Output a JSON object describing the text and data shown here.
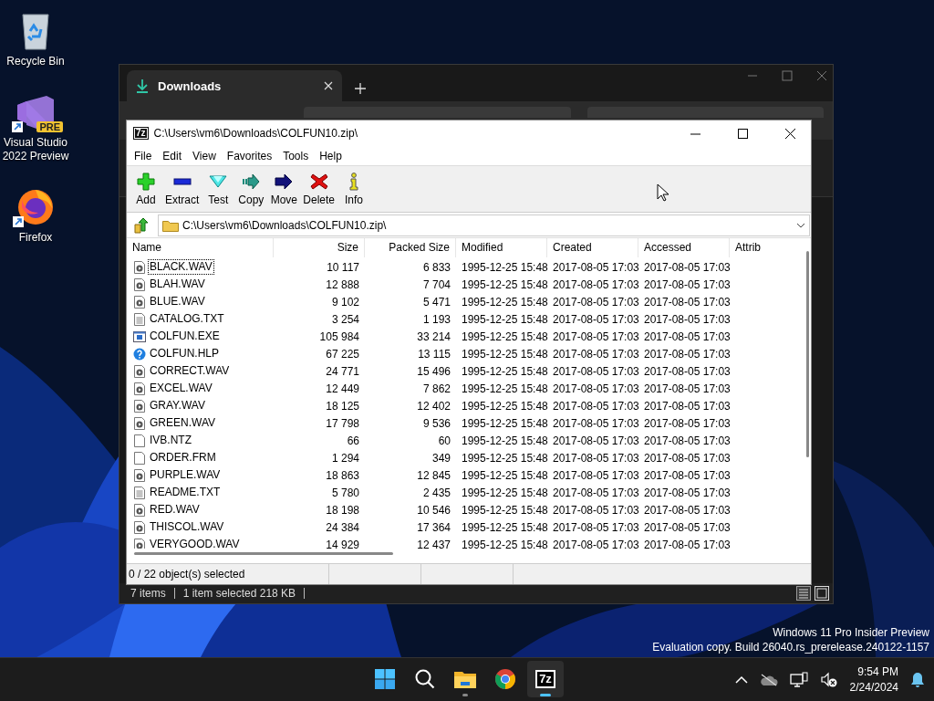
{
  "desktop_icons": [
    {
      "kind": "recycle",
      "label": "Recycle Bin"
    },
    {
      "kind": "vs",
      "label": "Visual Studio 2022 Preview",
      "badge": "PRE",
      "shortcut": true
    },
    {
      "kind": "firefox",
      "label": "Firefox",
      "shortcut": true
    }
  ],
  "explorer": {
    "tab": {
      "label": "Downloads",
      "selected": true
    },
    "status_bar": [
      "7 items",
      "1 item selected  218 KB"
    ]
  },
  "sevenzip": {
    "app_icon": "7z",
    "title": "C:\\Users\\vm6\\Downloads\\COLFUN10.zip\\",
    "menu": [
      "File",
      "Edit",
      "View",
      "Favorites",
      "Tools",
      "Help"
    ],
    "toolbar": [
      {
        "kind": "add",
        "label": "Add"
      },
      {
        "kind": "extract",
        "label": "Extract"
      },
      {
        "kind": "test",
        "label": "Test"
      },
      {
        "kind": "copy",
        "label": "Copy"
      },
      {
        "kind": "move",
        "label": "Move"
      },
      {
        "kind": "delete",
        "label": "Delete"
      },
      {
        "kind": "info",
        "label": "Info"
      }
    ],
    "path": "C:\\Users\\vm6\\Downloads\\COLFUN10.zip\\",
    "columns": [
      "Name",
      "Size",
      "Packed Size",
      "Modified",
      "Created",
      "Accessed",
      "Attrib"
    ],
    "rows": [
      {
        "kind": "wav",
        "name": "BLACK.WAV",
        "size": "10 117",
        "packed": "6 833",
        "modified": "1995-12-25 15:48",
        "created": "2017-08-05 17:03",
        "accessed": "2017-08-05 17:03",
        "focused": true
      },
      {
        "kind": "wav",
        "name": "BLAH.WAV",
        "size": "12 888",
        "packed": "7 704",
        "modified": "1995-12-25 15:48",
        "created": "2017-08-05 17:03",
        "accessed": "2017-08-05 17:03",
        "focused": false
      },
      {
        "kind": "wav",
        "name": "BLUE.WAV",
        "size": "9 102",
        "packed": "5 471",
        "modified": "1995-12-25 15:48",
        "created": "2017-08-05 17:03",
        "accessed": "2017-08-05 17:03",
        "focused": false
      },
      {
        "kind": "txt",
        "name": "CATALOG.TXT",
        "size": "3 254",
        "packed": "1 193",
        "modified": "1995-12-25 15:48",
        "created": "2017-08-05 17:03",
        "accessed": "2017-08-05 17:03",
        "focused": false
      },
      {
        "kind": "exe",
        "name": "COLFUN.EXE",
        "size": "105 984",
        "packed": "33 214",
        "modified": "1995-12-25 15:48",
        "created": "2017-08-05 17:03",
        "accessed": "2017-08-05 17:03",
        "focused": false
      },
      {
        "kind": "hlp",
        "name": "COLFUN.HLP",
        "size": "67 225",
        "packed": "13 115",
        "modified": "1995-12-25 15:48",
        "created": "2017-08-05 17:03",
        "accessed": "2017-08-05 17:03",
        "focused": false
      },
      {
        "kind": "wav",
        "name": "CORRECT.WAV",
        "size": "24 771",
        "packed": "15 496",
        "modified": "1995-12-25 15:48",
        "created": "2017-08-05 17:03",
        "accessed": "2017-08-05 17:03",
        "focused": false
      },
      {
        "kind": "wav",
        "name": "EXCEL.WAV",
        "size": "12 449",
        "packed": "7 862",
        "modified": "1995-12-25 15:48",
        "created": "2017-08-05 17:03",
        "accessed": "2017-08-05 17:03",
        "focused": false
      },
      {
        "kind": "wav",
        "name": "GRAY.WAV",
        "size": "18 125",
        "packed": "12 402",
        "modified": "1995-12-25 15:48",
        "created": "2017-08-05 17:03",
        "accessed": "2017-08-05 17:03",
        "focused": false
      },
      {
        "kind": "wav",
        "name": "GREEN.WAV",
        "size": "17 798",
        "packed": "9 536",
        "modified": "1995-12-25 15:48",
        "created": "2017-08-05 17:03",
        "accessed": "2017-08-05 17:03",
        "focused": false
      },
      {
        "kind": "file",
        "name": "IVB.NTZ",
        "size": "66",
        "packed": "60",
        "modified": "1995-12-25 15:48",
        "created": "2017-08-05 17:03",
        "accessed": "2017-08-05 17:03",
        "focused": false
      },
      {
        "kind": "file",
        "name": "ORDER.FRM",
        "size": "1 294",
        "packed": "349",
        "modified": "1995-12-25 15:48",
        "created": "2017-08-05 17:03",
        "accessed": "2017-08-05 17:03",
        "focused": false
      },
      {
        "kind": "wav",
        "name": "PURPLE.WAV",
        "size": "18 863",
        "packed": "12 845",
        "modified": "1995-12-25 15:48",
        "created": "2017-08-05 17:03",
        "accessed": "2017-08-05 17:03",
        "focused": false
      },
      {
        "kind": "txt",
        "name": "README.TXT",
        "size": "5 780",
        "packed": "2 435",
        "modified": "1995-12-25 15:48",
        "created": "2017-08-05 17:03",
        "accessed": "2017-08-05 17:03",
        "focused": false
      },
      {
        "kind": "wav",
        "name": "RED.WAV",
        "size": "18 198",
        "packed": "10 546",
        "modified": "1995-12-25 15:48",
        "created": "2017-08-05 17:03",
        "accessed": "2017-08-05 17:03",
        "focused": false
      },
      {
        "kind": "wav",
        "name": "THISCOL.WAV",
        "size": "24 384",
        "packed": "17 364",
        "modified": "1995-12-25 15:48",
        "created": "2017-08-05 17:03",
        "accessed": "2017-08-05 17:03",
        "focused": false
      },
      {
        "kind": "wav",
        "name": "VERYGOOD.WAV",
        "size": "14 929",
        "packed": "12 437",
        "modified": "1995-12-25 15:48",
        "created": "2017-08-05 17:03",
        "accessed": "2017-08-05 17:03",
        "focused": false
      }
    ],
    "status": "0 / 22 object(s) selected"
  },
  "system_notice": [
    "Windows 11 Pro Insider Preview",
    "Evaluation copy. Build 26040.rs_prerelease.240122-1157"
  ],
  "taskbar": {
    "apps": [
      {
        "kind": "start",
        "running": false,
        "selected": false
      },
      {
        "kind": "search",
        "running": false,
        "selected": false
      },
      {
        "kind": "explorer",
        "running": true,
        "selected": false
      },
      {
        "kind": "chrome",
        "running": false,
        "selected": false
      },
      {
        "kind": "sevenzip",
        "label": "7z",
        "running": true,
        "selected": true
      }
    ],
    "time": "9:54 PM",
    "date": "2/24/2024"
  }
}
